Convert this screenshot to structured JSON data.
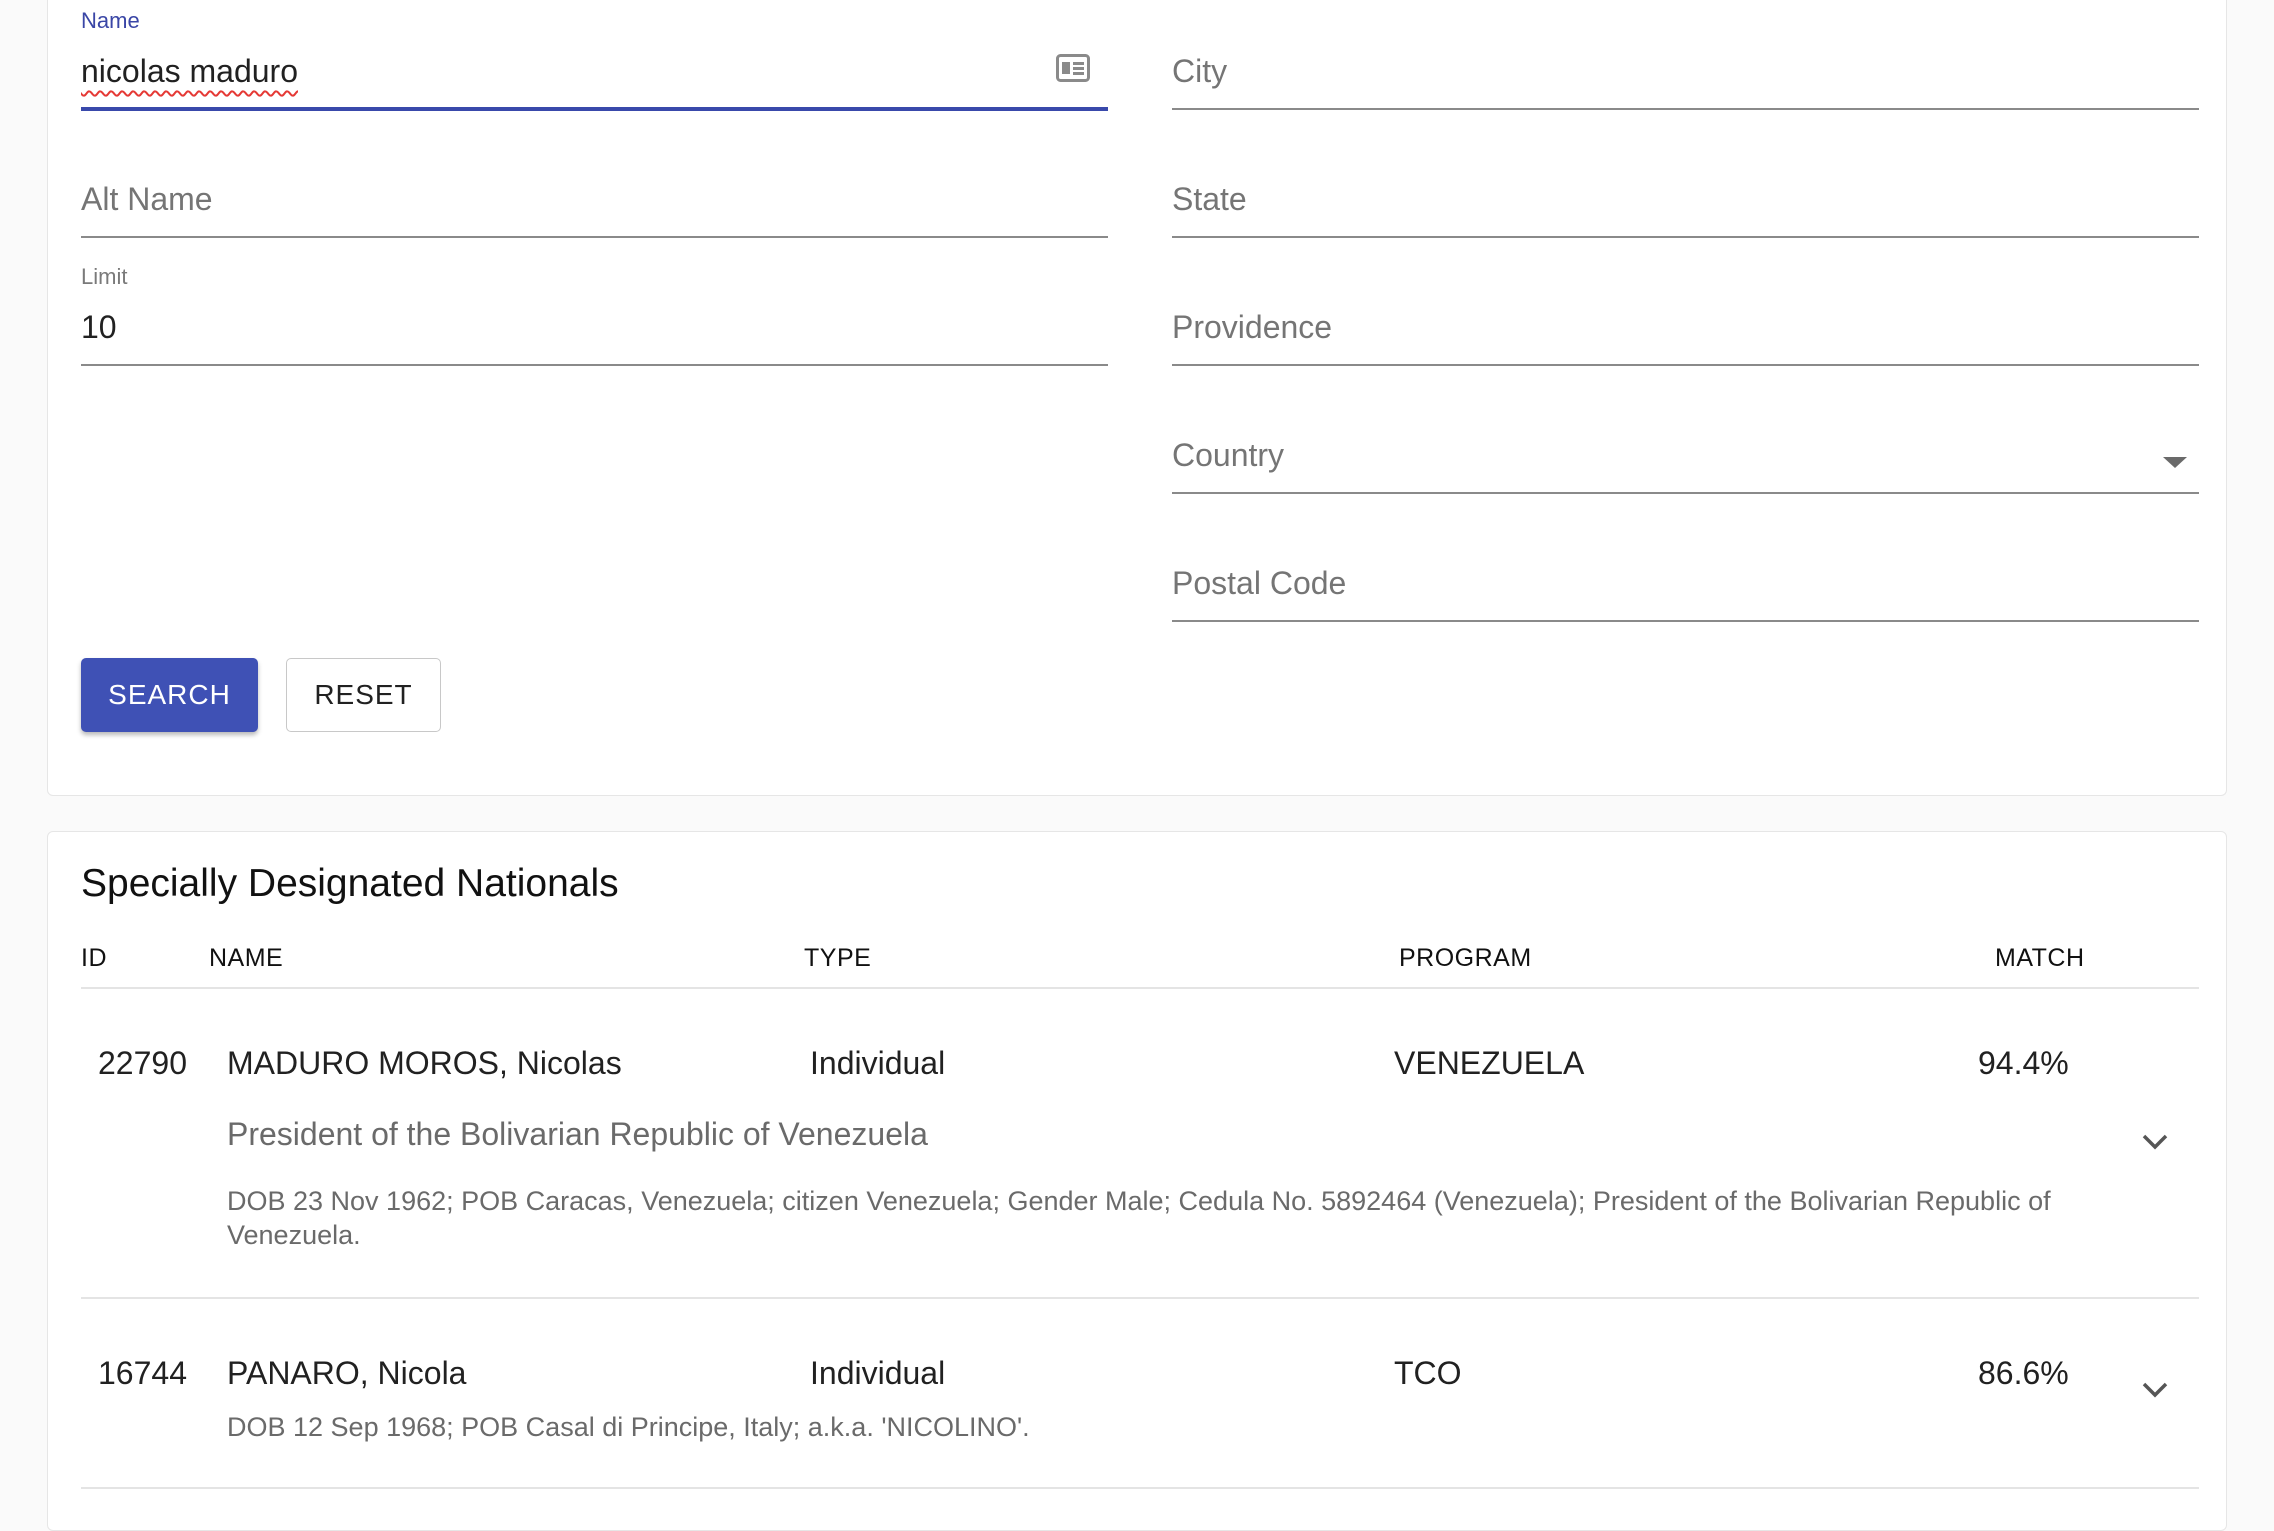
{
  "form": {
    "name": {
      "label": "Name",
      "value": "nicolas maduro",
      "icon": "contact-card-icon"
    },
    "city": {
      "placeholder": "City"
    },
    "alt_name": {
      "placeholder": "Alt Name"
    },
    "state": {
      "placeholder": "State"
    },
    "limit": {
      "label": "Limit",
      "value": "10"
    },
    "providence": {
      "placeholder": "Providence"
    },
    "country": {
      "placeholder": "Country",
      "icon": "dropdown-caret-icon"
    },
    "postal_code": {
      "placeholder": "Postal Code"
    },
    "search_label": "SEARCH",
    "reset_label": "RESET"
  },
  "results": {
    "title": "Specially Designated Nationals",
    "columns": [
      "ID",
      "NAME",
      "TYPE",
      "PROGRAM",
      "MATCH"
    ],
    "rows": [
      {
        "id": "22790",
        "name": "MADURO MOROS, Nicolas",
        "type": "Individual",
        "program": "VENEZUELA",
        "match": "94.4%",
        "subtitle": "President of the Bolivarian Republic of Venezuela",
        "remarks": "DOB 23 Nov 1962; POB Caracas, Venezuela; citizen Venezuela; Gender Male; Cedula No. 5892464 (Venezuela); President of the Bolivarian Republic of Venezuela."
      },
      {
        "id": "16744",
        "name": "PANARO, Nicola",
        "type": "Individual",
        "program": "TCO",
        "match": "86.6%",
        "subtitle": "",
        "remarks": "DOB 12 Sep 1968; POB Casal di Principe, Italy; a.k.a. 'NICOLINO'."
      }
    ]
  },
  "colors": {
    "primary": "#3f51b5",
    "focus_label": "#3a46a6",
    "spellcheck": "#e53935"
  }
}
